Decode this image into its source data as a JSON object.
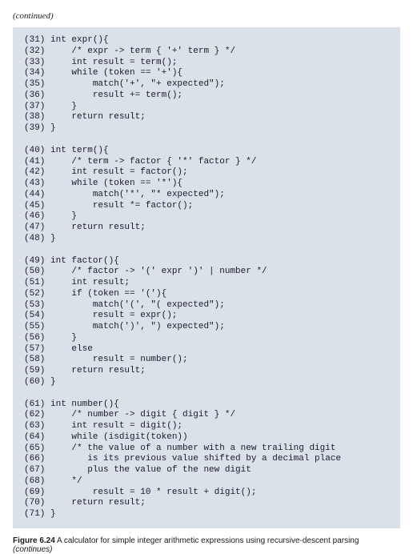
{
  "continued": "(continued)",
  "code": {
    "lines": [
      {
        "num": "(31)",
        "text": "int expr(){"
      },
      {
        "num": "(32)",
        "text": "    /* expr -> term { '+' term } */"
      },
      {
        "num": "(33)",
        "text": "    int result = term();"
      },
      {
        "num": "(34)",
        "text": "    while (token == '+'){"
      },
      {
        "num": "(35)",
        "text": "        match('+', \"+ expected\");"
      },
      {
        "num": "(36)",
        "text": "        result += term();"
      },
      {
        "num": "(37)",
        "text": "    }"
      },
      {
        "num": "(38)",
        "text": "    return result;"
      },
      {
        "num": "(39)",
        "text": "}"
      },
      {
        "blank": true
      },
      {
        "num": "(40)",
        "text": "int term(){"
      },
      {
        "num": "(41)",
        "text": "    /* term -> factor { '*' factor } */"
      },
      {
        "num": "(42)",
        "text": "    int result = factor();"
      },
      {
        "num": "(43)",
        "text": "    while (token == '*'){"
      },
      {
        "num": "(44)",
        "text": "        match('*', \"* expected\");"
      },
      {
        "num": "(45)",
        "text": "        result *= factor();"
      },
      {
        "num": "(46)",
        "text": "    }"
      },
      {
        "num": "(47)",
        "text": "    return result;"
      },
      {
        "num": "(48)",
        "text": "}"
      },
      {
        "blank": true
      },
      {
        "num": "(49)",
        "text": "int factor(){"
      },
      {
        "num": "(50)",
        "text": "    /* factor -> '(' expr ')' | number */"
      },
      {
        "num": "(51)",
        "text": "    int result;"
      },
      {
        "num": "(52)",
        "text": "    if (token == '('){"
      },
      {
        "num": "(53)",
        "text": "        match('(', \"( expected\");"
      },
      {
        "num": "(54)",
        "text": "        result = expr();"
      },
      {
        "num": "(55)",
        "text": "        match(')', \") expected\");"
      },
      {
        "num": "(56)",
        "text": "    }"
      },
      {
        "num": "(57)",
        "text": "    else"
      },
      {
        "num": "(58)",
        "text": "        result = number();"
      },
      {
        "num": "(59)",
        "text": "    return result;"
      },
      {
        "num": "(60)",
        "text": "}"
      },
      {
        "blank": true
      },
      {
        "num": "(61)",
        "text": "int number(){"
      },
      {
        "num": "(62)",
        "text": "    /* number -> digit { digit } */"
      },
      {
        "num": "(63)",
        "text": "    int result = digit();"
      },
      {
        "num": "(64)",
        "text": "    while (isdigit(token))"
      },
      {
        "num": "(65)",
        "text": "    /* the value of a number with a new trailing digit"
      },
      {
        "num": "(66)",
        "text": "       is its previous value shifted by a decimal place"
      },
      {
        "num": "(67)",
        "text": "       plus the value of the new digit"
      },
      {
        "num": "(68)",
        "text": "    */"
      },
      {
        "num": "(69)",
        "text": "        result = 10 * result + digit();"
      },
      {
        "num": "(70)",
        "text": "    return result;"
      },
      {
        "num": "(71)",
        "text": "}"
      }
    ]
  },
  "caption": {
    "figure_label": "Figure 6.24",
    "text": " A calculator for simple integer arithmetic expressions using recursive-descent parsing ",
    "continues": "(continues)"
  }
}
